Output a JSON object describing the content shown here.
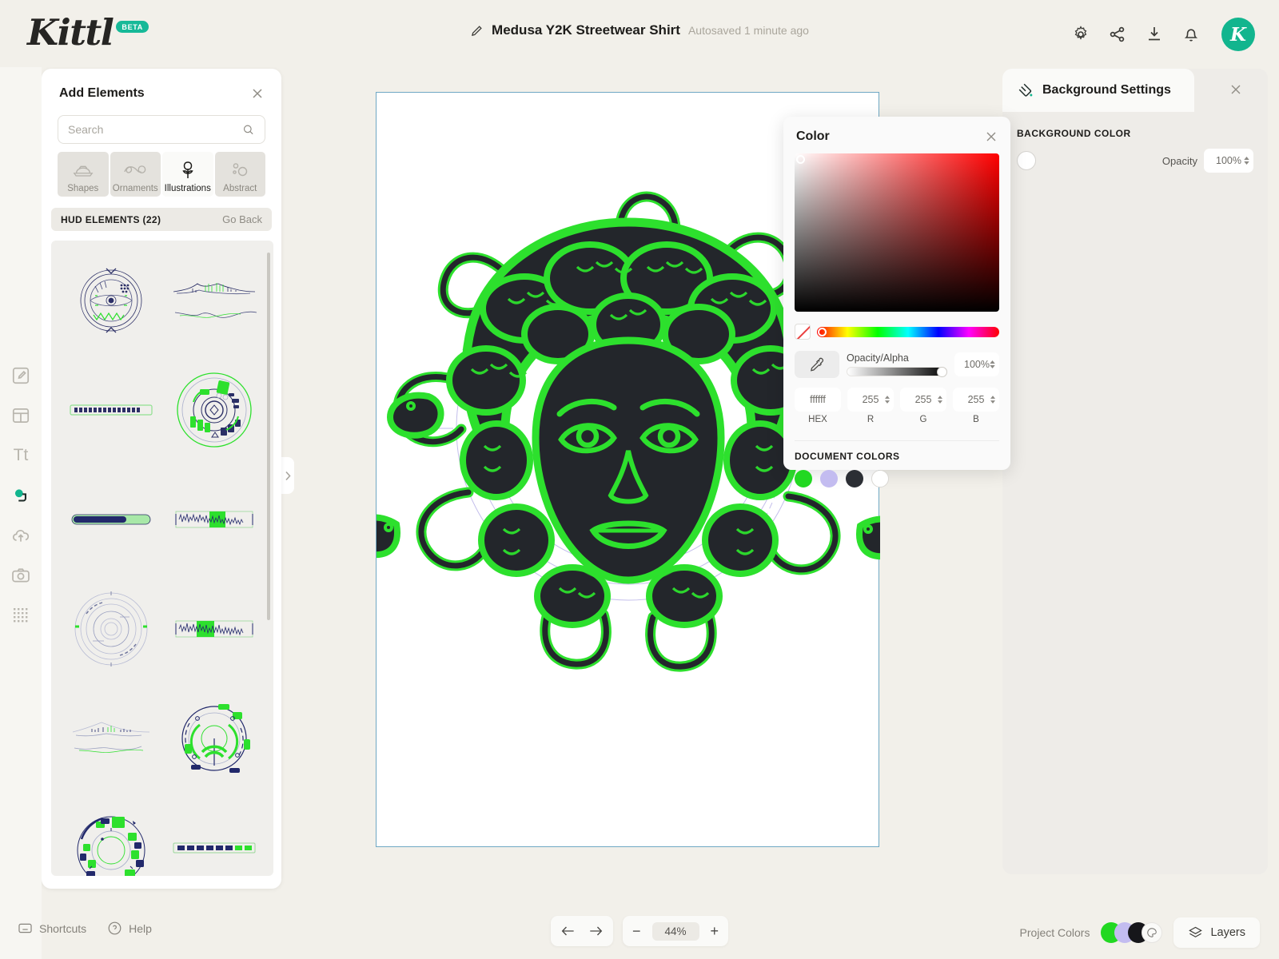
{
  "header": {
    "logo_text": "Kittl",
    "beta_badge": "BETA",
    "doc_title": "Medusa Y2K Streetwear Shirt",
    "autosave_text": "Autosaved 1 minute ago",
    "icons": [
      "gear-icon",
      "share-icon",
      "download-icon",
      "bell-icon"
    ],
    "avatar_initial": "K",
    "avatar_color": "#12b58e",
    "brand_color": "#17b998"
  },
  "left_rail": {
    "items": [
      {
        "name": "design-tool",
        "active": false
      },
      {
        "name": "templates-tool",
        "active": false
      },
      {
        "name": "text-tool",
        "active": false
      },
      {
        "name": "elements-tool",
        "active": true
      },
      {
        "name": "uploads-tool",
        "active": false
      },
      {
        "name": "photos-tool",
        "active": false
      },
      {
        "name": "grid-tool",
        "active": false
      }
    ]
  },
  "panel": {
    "title": "Add Elements",
    "close_icon": "close-icon",
    "search": {
      "placeholder": "Search",
      "value": "",
      "icon": "search-icon"
    },
    "tabs": [
      {
        "label": "Shapes",
        "icon": "shapes-icon",
        "active": false
      },
      {
        "label": "Ornaments",
        "icon": "ornaments-icon",
        "active": false
      },
      {
        "label": "Illustrations",
        "icon": "illustrations-icon",
        "active": true
      },
      {
        "label": "Abstract",
        "icon": "abstract-icon",
        "active": false
      }
    ],
    "category": {
      "title": "HUD ELEMENTS (22)",
      "go_back": "Go Back",
      "count": 22
    },
    "thumbnails": [
      {
        "name": "hud-radar-dial-1",
        "type": "dial"
      },
      {
        "name": "hud-waveform-landscape-1",
        "type": "landscape"
      },
      {
        "name": "hud-progress-bar-1",
        "type": "bar-segments"
      },
      {
        "name": "hud-radar-dial-2",
        "type": "dial-green"
      },
      {
        "name": "hud-progress-bar-2",
        "type": "bar-solid"
      },
      {
        "name": "hud-waveform-strip-1",
        "type": "waveform"
      },
      {
        "name": "hud-radar-dial-3",
        "type": "dial-faint"
      },
      {
        "name": "hud-waveform-strip-2",
        "type": "waveform"
      },
      {
        "name": "hud-waveform-landscape-2",
        "type": "landscape"
      },
      {
        "name": "hud-radar-dial-4",
        "type": "dial-arcs"
      },
      {
        "name": "hud-radar-dial-5",
        "type": "dial-blocks"
      },
      {
        "name": "hud-progress-bar-3",
        "type": "bar-segments"
      }
    ],
    "collapse_icon": "chevron-right-icon"
  },
  "canvas": {
    "artwork_name": "medusa-illustration",
    "artwork_colors": {
      "outline": "#2de02d",
      "fill": "#23262b",
      "hud_accent": "#b9b3e8"
    }
  },
  "color_popover": {
    "title": "Color",
    "close_icon": "close-icon",
    "no_color_swatch": "no-color-swatch",
    "eyedropper_icon": "eyedropper-icon",
    "opacity_label": "Opacity/Alpha",
    "opacity_value": "100%",
    "fields": [
      {
        "label": "HEX",
        "value": "ffffff",
        "stepper": false
      },
      {
        "label": "R",
        "value": "255",
        "stepper": true
      },
      {
        "label": "G",
        "value": "255",
        "stepper": true
      },
      {
        "label": "B",
        "value": "255",
        "stepper": true
      }
    ],
    "document_colors_label": "DOCUMENT COLORS",
    "document_colors": [
      "#22d822",
      "#c3bcf0",
      "#2b2e34",
      "#ffffff"
    ]
  },
  "background_settings": {
    "title": "Background Settings",
    "icon": "paint-bucket-icon",
    "close_icon": "close-icon",
    "section_label": "BACKGROUND COLOR",
    "swatch_color": "#ffffff",
    "opacity_label": "Opacity",
    "opacity_value": "100%"
  },
  "bottom_bar": {
    "shortcuts_label": "Shortcuts",
    "shortcuts_icon": "keyboard-icon",
    "help_label": "Help",
    "help_icon": "question-circle-icon",
    "undo_icon": "undo-arrow-icon",
    "redo_icon": "redo-arrow-icon",
    "zoom_out": "−",
    "zoom_level": "44%",
    "zoom_in": "+",
    "project_colors_label": "Project Colors",
    "project_colors": [
      "#22d822",
      "#c3bcf0",
      "#16161a"
    ],
    "palette_icon": "palette-icon",
    "layers_label": "Layers",
    "layers_icon": "layers-icon"
  }
}
